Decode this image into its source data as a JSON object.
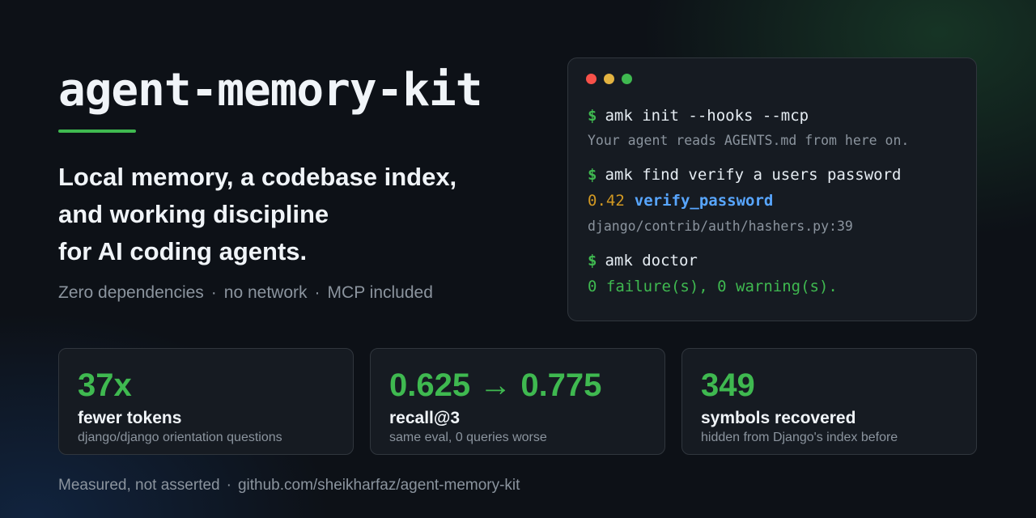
{
  "title": "agent-memory-kit",
  "tagline": [
    "Local memory, a codebase index,",
    "and working discipline",
    "for AI coding agents."
  ],
  "subtags": [
    "Zero dependencies",
    "no network",
    "MCP included"
  ],
  "separator": "·",
  "colors": {
    "accent": "#3fb950",
    "background": "#0d1117",
    "panel": "#161b22",
    "score": "#d29922",
    "symbol": "#58a6ff"
  },
  "terminal": {
    "prompt": "$",
    "commands": [
      {
        "cmd": "amk init --hooks --mcp",
        "output": "Your agent reads AGENTS.md from here on."
      },
      {
        "cmd": "amk find verify a users password",
        "score": "0.42",
        "symbol": "verify_password",
        "path": "django/contrib/auth/hashers.py:39"
      },
      {
        "cmd": "amk doctor",
        "output": "0 failure(s), 0 warning(s)."
      }
    ]
  },
  "stats": [
    {
      "value": "37x",
      "label": "fewer tokens",
      "desc": "django/django orientation questions"
    },
    {
      "value": "0.625 → 0.775",
      "label": "recall@3",
      "desc": "same eval, 0 queries worse"
    },
    {
      "value": "349",
      "label": "symbols recovered",
      "desc": "hidden from Django's index before"
    }
  ],
  "footer": {
    "note": "Measured, not asserted",
    "repo": "github.com/sheikharfaz/agent-memory-kit"
  }
}
